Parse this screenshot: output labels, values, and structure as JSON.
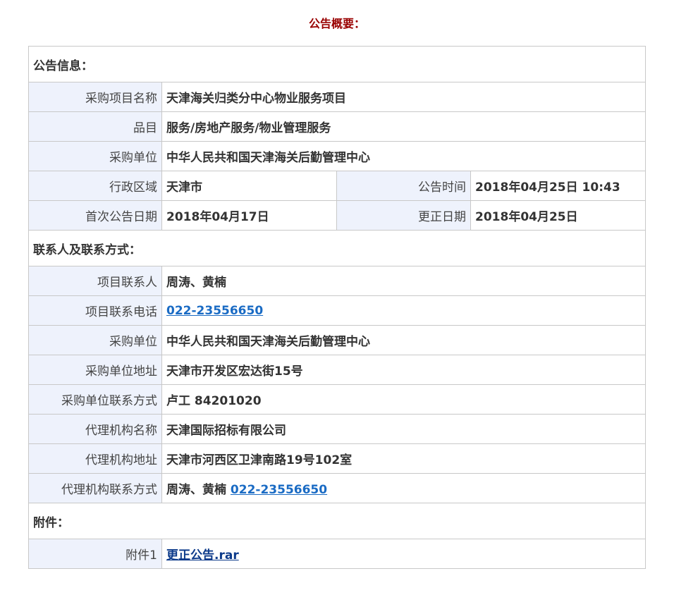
{
  "title": "公告概要：",
  "sections": {
    "info": "公告信息：",
    "contact": "联系人及联系方式：",
    "attachment": "附件："
  },
  "info": {
    "project_name_label": "采购项目名称",
    "project_name": "天津海关归类分中心物业服务项目",
    "category_label": "品目",
    "category": "服务/房地产服务/物业管理服务",
    "buyer_label": "采购单位",
    "buyer": "中华人民共和国天津海关后勤管理中心",
    "region_label": "行政区域",
    "region": "天津市",
    "announce_time_label": "公告时间",
    "announce_time": "2018年04月25日 10:43",
    "first_date_label": "首次公告日期",
    "first_date": "2018年04月17日",
    "correction_date_label": "更正日期",
    "correction_date": "2018年04月25日"
  },
  "contact": {
    "contact_person_label": "项目联系人",
    "contact_person": "周涛、黄楠",
    "contact_phone_label": "项目联系电话",
    "contact_phone": "022-23556650",
    "buyer_label": "采购单位",
    "buyer": "中华人民共和国天津海关后勤管理中心",
    "buyer_address_label": "采购单位地址",
    "buyer_address": "天津市开发区宏达街15号",
    "buyer_contact_label": "采购单位联系方式",
    "buyer_contact": "卢工 84201020",
    "agency_name_label": "代理机构名称",
    "agency_name": "天津国际招标有限公司",
    "agency_address_label": "代理机构地址",
    "agency_address": "天津市河西区卫津南路19号102室",
    "agency_contact_label": "代理机构联系方式",
    "agency_contact_person": "周涛、黄楠",
    "agency_contact_phone": "022-23556650"
  },
  "attachment": {
    "label": "附件1",
    "file": "更正公告.rar"
  }
}
